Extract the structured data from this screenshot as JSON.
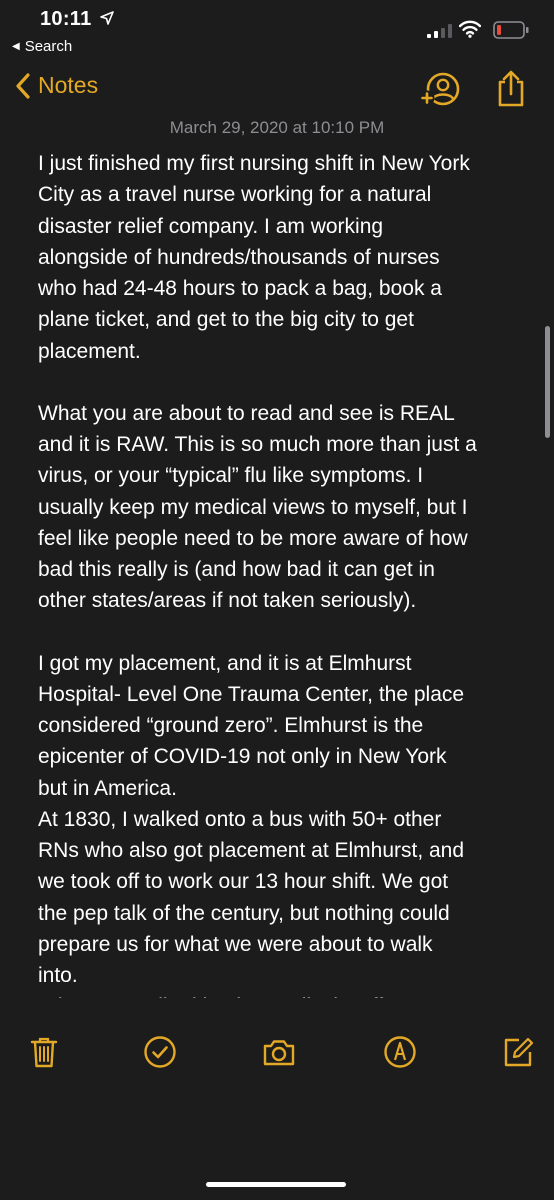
{
  "status_bar": {
    "time": "10:11",
    "back_app": "Search",
    "battery_color": "#e94b3c"
  },
  "nav": {
    "back_label": "Notes",
    "accent_color": "#e3a826",
    "icons": [
      "chevron-left-icon",
      "add-person-icon",
      "share-icon"
    ]
  },
  "note": {
    "date": "March 29, 2020 at 10:10 PM",
    "paragraphs": [
      "I just finished my first nursing shift in New York\nCity as a travel nurse working for a natural\ndisaster relief company. I am working\nalongside of hundreds/thousands of nurses\nwho had 24-48 hours to pack a bag, book a\nplane ticket, and get to the big city to get\nplacement.",
      "What you are about to read and see is REAL\nand it is RAW. This is so much more than just a\nvirus, or your “typical” flu like symptoms. I\nusually keep my medical views to myself, but I\nfeel like people need to be more aware of how\nbad this really is (and how bad it can get in\nother states/areas if not taken seriously).",
      "I got my placement, and it is at Elmhurst\nHospital- Level One Trauma Center, the place\nconsidered “ground zero”. Elmhurst is the\nepicenter of COVID-19 not only in New York\nbut in America.\nAt 1830, I walked onto a bus with 50+ other\nRNs who also got placement at Elmhurst, and\nwe took off to work our 13 hour shift. We got\nthe pep talk of the century, but nothing could\nprepare us for what we were about to walk\ninto.\nWhen we walked in, the medical staff was so\nhappy to see us they literally cried out in"
    ]
  },
  "toolbar": {
    "icons": [
      "trash-icon",
      "checklist-icon",
      "camera-icon",
      "markup-icon",
      "compose-icon"
    ]
  }
}
